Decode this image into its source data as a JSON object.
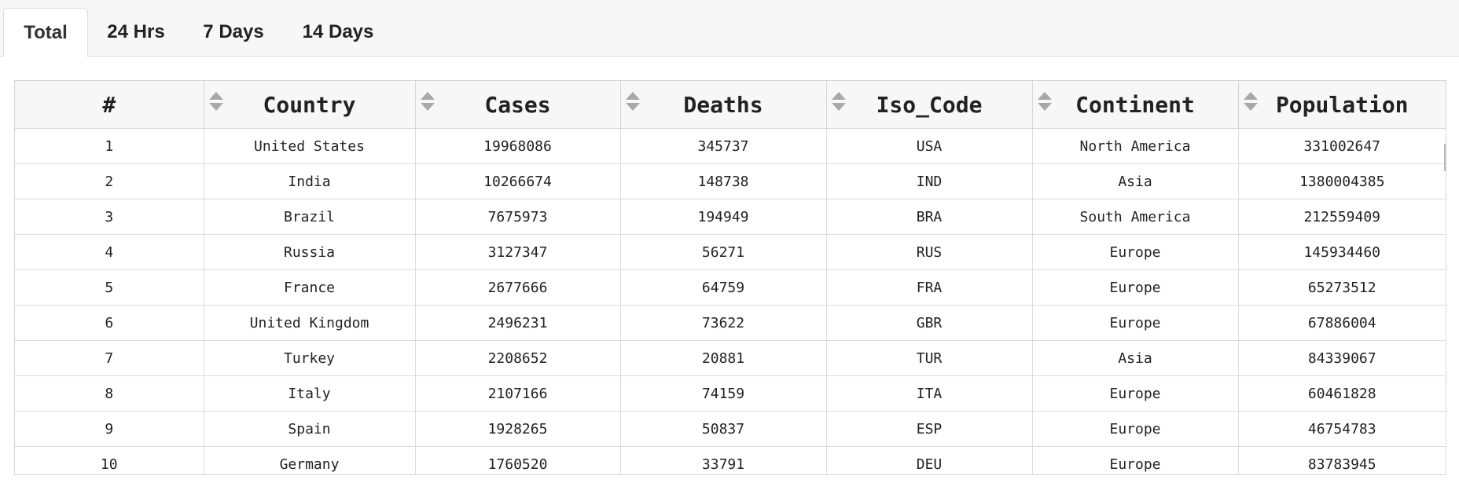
{
  "tabs": [
    {
      "label": "Total",
      "active": true
    },
    {
      "label": "24 Hrs",
      "active": false
    },
    {
      "label": "7 Days",
      "active": false
    },
    {
      "label": "14 Days",
      "active": false
    }
  ],
  "table": {
    "headers": [
      "#",
      "Country",
      "Cases",
      "Deaths",
      "Iso_Code",
      "Continent",
      "Population"
    ],
    "sort_icon": "sort-arrows-icon",
    "rows": [
      [
        "1",
        "United States",
        "19968086",
        "345737",
        "USA",
        "North America",
        "331002647"
      ],
      [
        "2",
        "India",
        "10266674",
        "148738",
        "IND",
        "Asia",
        "1380004385"
      ],
      [
        "3",
        "Brazil",
        "7675973",
        "194949",
        "BRA",
        "South America",
        "212559409"
      ],
      [
        "4",
        "Russia",
        "3127347",
        "56271",
        "RUS",
        "Europe",
        "145934460"
      ],
      [
        "5",
        "France",
        "2677666",
        "64759",
        "FRA",
        "Europe",
        "65273512"
      ],
      [
        "6",
        "United Kingdom",
        "2496231",
        "73622",
        "GBR",
        "Europe",
        "67886004"
      ],
      [
        "7",
        "Turkey",
        "2208652",
        "20881",
        "TUR",
        "Asia",
        "84339067"
      ],
      [
        "8",
        "Italy",
        "2107166",
        "74159",
        "ITA",
        "Europe",
        "60461828"
      ],
      [
        "9",
        "Spain",
        "1928265",
        "50837",
        "ESP",
        "Europe",
        "46754783"
      ],
      [
        "10",
        "Germany",
        "1760520",
        "33791",
        "DEU",
        "Europe",
        "83783945"
      ]
    ]
  },
  "colors": {
    "header_bg": "#f7f7f7",
    "border": "#d6d6d6",
    "text": "#222222",
    "sort_arrow": "#a8a8a8"
  }
}
